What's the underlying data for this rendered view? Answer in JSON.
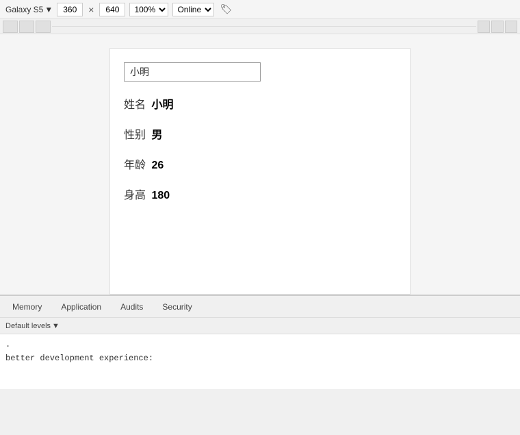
{
  "toolbar": {
    "device_label": "Galaxy S5",
    "device_arrow": "▼",
    "width_value": "360",
    "close_symbol": "×",
    "height_value": "640",
    "zoom_label": "100%",
    "zoom_arrow": "▼",
    "online_label": "Online",
    "online_arrow": "▼",
    "tag_icon": "🏷"
  },
  "card": {
    "input_value": "小明",
    "input_placeholder": "",
    "fields": [
      {
        "label": "姓名",
        "value": "小明"
      },
      {
        "label": "性别",
        "value": "男"
      },
      {
        "label": "年龄",
        "value": "26"
      },
      {
        "label": "身高",
        "value": "180"
      }
    ]
  },
  "tabs": [
    {
      "label": "Memory",
      "active": false
    },
    {
      "label": "Application",
      "active": false
    },
    {
      "label": "Audits",
      "active": false
    },
    {
      "label": "Security",
      "active": false
    }
  ],
  "filter": {
    "label": "Default levels",
    "arrow": "▼"
  },
  "console": {
    "line1": ".",
    "line2": "better development experience:"
  }
}
